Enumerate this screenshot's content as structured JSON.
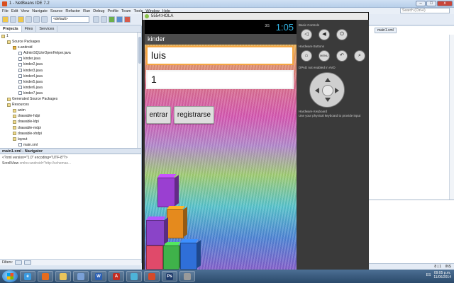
{
  "ide": {
    "title": "1 - NetBeans IDE 7.2",
    "menu": [
      "File",
      "Edit",
      "View",
      "Navigate",
      "Source",
      "Refactor",
      "Run",
      "Debug",
      "Profile",
      "Team",
      "Tools",
      "Window",
      "Help"
    ],
    "search_placeholder": "Search (Ctrl+I)",
    "config_select": "<default>"
  },
  "projects_panel": {
    "tabs": [
      "Projects",
      "Files",
      "Services"
    ],
    "tree": [
      {
        "label": "1",
        "kind": "project",
        "indent": 0
      },
      {
        "label": "Source Packages",
        "kind": "folder",
        "indent": 1
      },
      {
        "label": "s.android",
        "kind": "pkg",
        "indent": 2
      },
      {
        "label": "AdminSQLiteOpenHelper.java",
        "kind": "file",
        "indent": 3
      },
      {
        "label": "kinder.java",
        "kind": "file",
        "indent": 3
      },
      {
        "label": "kinder2.java",
        "kind": "file",
        "indent": 3
      },
      {
        "label": "kinder3.java",
        "kind": "file",
        "indent": 3
      },
      {
        "label": "kinder4.java",
        "kind": "file",
        "indent": 3
      },
      {
        "label": "kinder5.java",
        "kind": "file",
        "indent": 3
      },
      {
        "label": "kinder6.java",
        "kind": "file",
        "indent": 3
      },
      {
        "label": "kinder7.java",
        "kind": "file",
        "indent": 3
      },
      {
        "label": "Generated Source Packages",
        "kind": "folder",
        "indent": 1
      },
      {
        "label": "Resources",
        "kind": "folder",
        "indent": 1
      },
      {
        "label": "anim",
        "kind": "folder",
        "indent": 2
      },
      {
        "label": "drawable-hdpi",
        "kind": "folder",
        "indent": 2
      },
      {
        "label": "drawable-ldpi",
        "kind": "folder",
        "indent": 2
      },
      {
        "label": "drawable-mdpi",
        "kind": "folder",
        "indent": 2
      },
      {
        "label": "drawable-xhdpi",
        "kind": "folder",
        "indent": 2
      },
      {
        "label": "layout",
        "kind": "folder",
        "indent": 2
      },
      {
        "label": "main.xml",
        "kind": "file",
        "indent": 3
      }
    ]
  },
  "navigator": {
    "title": "main1.xml - Navigator",
    "line1": "<?xml version=\"1.0\" encoding=\"UTF-8\"?>",
    "line2_tag": "ScrollView",
    "line2_attr": "xmlns:android=\"http://schemas...",
    "filters_label": "Filters:"
  },
  "editor": {
    "tab": "main1.xml",
    "position": "8 | 1",
    "mode": "INS"
  },
  "emulator": {
    "window_title": "5554:HOLA",
    "signal": "3G",
    "clock": "1:05",
    "app_title": "kinder",
    "user_field": "luis",
    "password_field": "1",
    "btn_enter": "entrar",
    "btn_register": "registrarse",
    "controls": {
      "basic_controls": "Basic Controls",
      "hardware_buttons": "Hardware Buttons",
      "dpad_label": "DPAD not enabled in AVD",
      "hardware_keyboard": "Hardware Keyboard",
      "keyboard_hint": "Use your physical keyboard to provide input",
      "menu_btn": "MENU"
    },
    "cube_colors": [
      "#9a3fd1",
      "#e58a1d",
      "#e04a6a",
      "#3fb24a",
      "#2f6fd8",
      "#8a44c8"
    ]
  },
  "taskbar": {
    "lang": "ES",
    "time": "09:05 p.m.",
    "date": "11/06/2014",
    "apps": [
      {
        "name": "internet-explorer",
        "label": "e",
        "color": "#3a9ae0"
      },
      {
        "name": "firefox",
        "label": "",
        "color": "#e56c1f"
      },
      {
        "name": "file-explorer",
        "label": "",
        "color": "#e9c45a"
      },
      {
        "name": "netbeans",
        "label": "",
        "color": "#7aa0d6"
      },
      {
        "name": "word",
        "label": "W",
        "color": "#2b5fb3"
      },
      {
        "name": "acrobat",
        "label": "A",
        "color": "#c22b22"
      },
      {
        "name": "jeweled",
        "label": "",
        "color": "#4db3d9"
      },
      {
        "name": "java",
        "label": "",
        "color": "#d44a2a"
      },
      {
        "name": "photoshop",
        "label": "Ps",
        "color": "#1e3a6a"
      },
      {
        "name": "media",
        "label": "",
        "color": "#9a9a9a"
      }
    ]
  }
}
